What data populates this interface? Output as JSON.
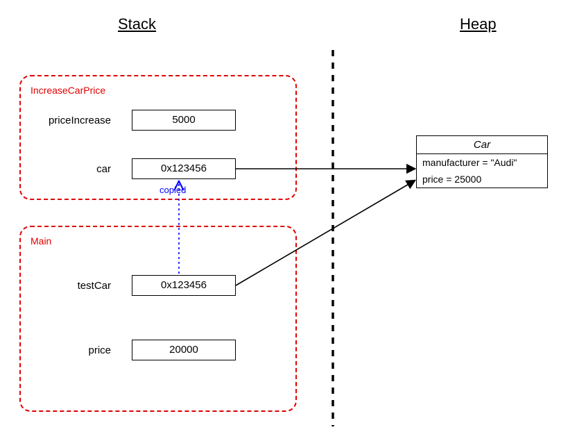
{
  "headings": {
    "stack": "Stack",
    "heap": "Heap"
  },
  "frames": {
    "increase": {
      "label": "IncreaseCarPrice",
      "vars": {
        "priceIncrease": {
          "label": "priceIncrease",
          "value": "5000"
        },
        "car": {
          "label": "car",
          "value": "0x123456"
        }
      }
    },
    "main": {
      "label": "Main",
      "vars": {
        "testCar": {
          "label": "testCar",
          "value": "0x123456"
        },
        "price": {
          "label": "price",
          "value": "20000"
        }
      }
    }
  },
  "copiedLabel": "copied",
  "heapObject": {
    "title": "Car",
    "fields": {
      "manufacturer": "manufacturer = \"Audi\"",
      "price": "price = 25000"
    }
  }
}
